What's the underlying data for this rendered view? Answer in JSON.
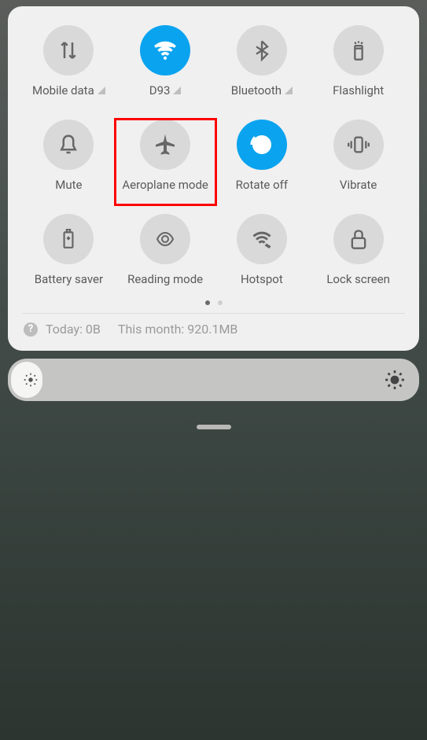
{
  "tiles": [
    {
      "label": "Mobile data",
      "active": false,
      "signal": true,
      "icon": "mobile-data"
    },
    {
      "label": "D93",
      "active": true,
      "signal": true,
      "icon": "wifi"
    },
    {
      "label": "Bluetooth",
      "active": false,
      "signal": true,
      "icon": "bluetooth"
    },
    {
      "label": "Flashlight",
      "active": false,
      "signal": false,
      "icon": "flashlight"
    },
    {
      "label": "Mute",
      "active": false,
      "signal": false,
      "icon": "mute"
    },
    {
      "label": "Aeroplane mode",
      "active": false,
      "signal": false,
      "icon": "airplane"
    },
    {
      "label": "Rotate off",
      "active": true,
      "signal": false,
      "icon": "rotate"
    },
    {
      "label": "Vibrate",
      "active": false,
      "signal": false,
      "icon": "vibrate"
    },
    {
      "label": "Battery saver",
      "active": false,
      "signal": false,
      "icon": "battery"
    },
    {
      "label": "Reading mode",
      "active": false,
      "signal": false,
      "icon": "reading"
    },
    {
      "label": "Hotspot",
      "active": false,
      "signal": false,
      "icon": "hotspot"
    },
    {
      "label": "Lock screen",
      "active": false,
      "signal": false,
      "icon": "lock"
    }
  ],
  "data_usage": {
    "today": "Today: 0B",
    "month": "This month: 920.1MB"
  },
  "page_dots": {
    "count": 2,
    "active": 0
  },
  "highlight_index": 5
}
